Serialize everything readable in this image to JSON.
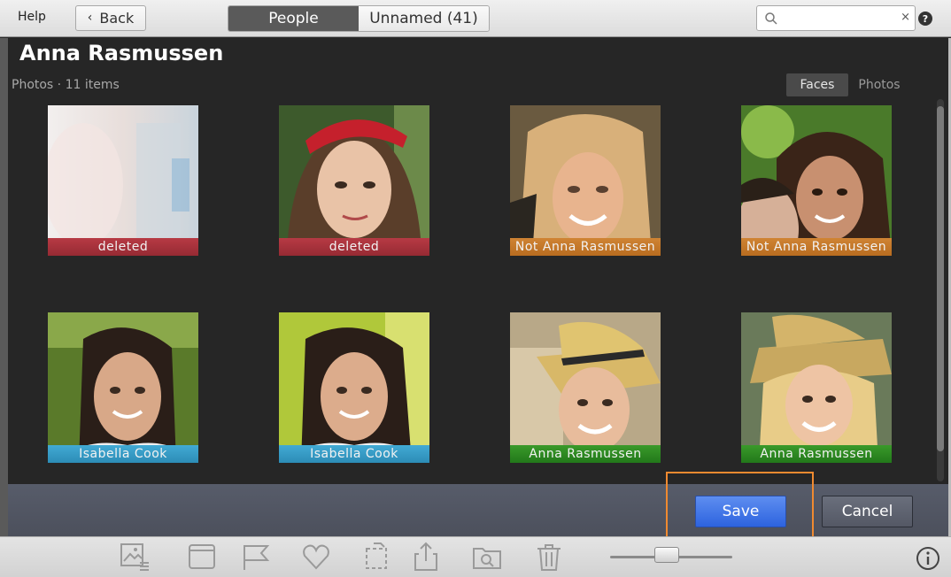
{
  "topbar": {
    "help_label": "Help",
    "back_label": "Back",
    "tabs": [
      {
        "label": "People",
        "active": true
      },
      {
        "label": "Unnamed (41)",
        "active": false
      }
    ],
    "search": {
      "value": "",
      "placeholder": "",
      "clear_glyph": "×"
    },
    "help_icon_glyph": "?"
  },
  "person": {
    "name": "Anna Rasmussen",
    "subtitle": "Photos · 11 items"
  },
  "view_toggle": {
    "faces_label": "Faces",
    "photos_label": "Photos",
    "active": "faces"
  },
  "faces": [
    {
      "label": "deleted",
      "status": "deleted",
      "label_color": "#a8303a"
    },
    {
      "label": "deleted",
      "status": "deleted",
      "label_color": "#a8303a"
    },
    {
      "label": "Not Anna Rasmussen",
      "status": "rejected",
      "label_color": "#c9782c"
    },
    {
      "label": "Not Anna Rasmussen",
      "status": "rejected",
      "label_color": "#c9782c"
    },
    {
      "label": "Isabella Cook",
      "status": "other",
      "label_color": "#3a9ec7"
    },
    {
      "label": "Isabella Cook",
      "status": "other",
      "label_color": "#3a9ec7"
    },
    {
      "label": "Anna Rasmussen",
      "status": "confirmed",
      "label_color": "#2e8a22"
    },
    {
      "label": "Anna Rasmussen",
      "status": "confirmed",
      "label_color": "#2e8a22"
    }
  ],
  "actions": {
    "save_label": "Save",
    "cancel_label": "Cancel"
  },
  "toolbar": {
    "icons": [
      "image-info-icon",
      "window-icon",
      "flag-icon",
      "heart-icon",
      "rotate-crop-icon",
      "share-icon",
      "folder-search-icon",
      "trash-icon"
    ],
    "zoom_level": 0.45,
    "info_glyph": "i"
  },
  "colors": {
    "save_accent": "#2d63df",
    "highlight_box": "#f08a30"
  }
}
